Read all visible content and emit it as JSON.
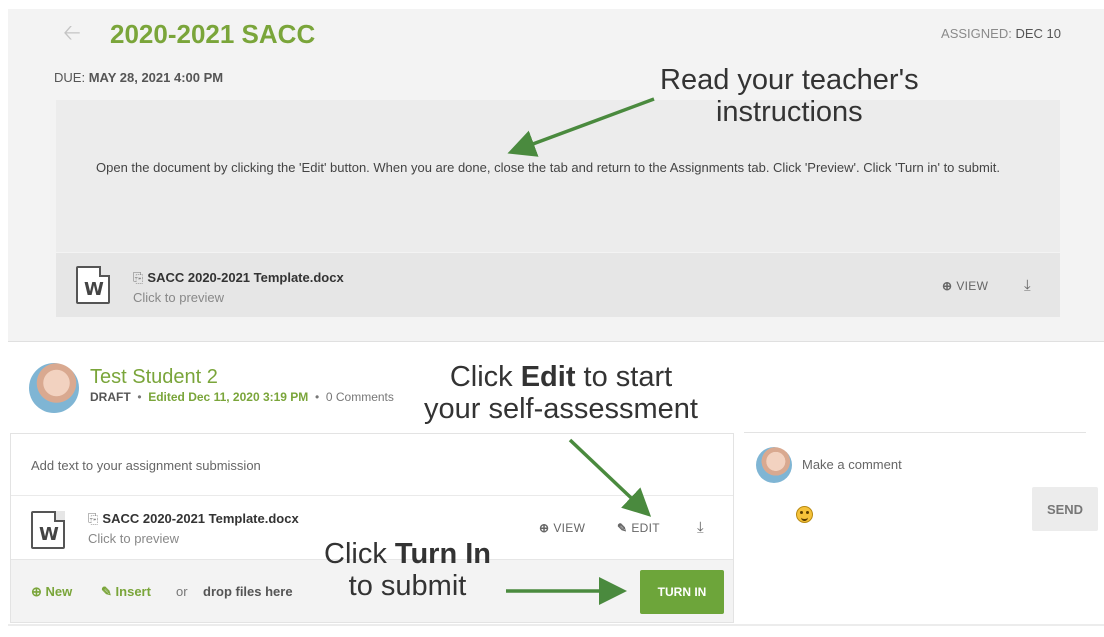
{
  "assignment": {
    "title": "2020-2021 SACC",
    "assigned_label": "ASSIGNED:",
    "assigned_date": "DEC 10",
    "due_label": "DUE:",
    "due_date": "MAY 28, 2021 4:00 PM",
    "instructions": "Open the document by clicking the 'Edit' button.  When you are done, close the tab and return to the Assignments tab.  Click 'Preview'.  Click 'Turn in' to submit.",
    "attachment": {
      "name": "SACC 2020-2021 Template.docx",
      "subtitle": "Click to preview",
      "view_label": "VIEW"
    }
  },
  "submission": {
    "student_name": "Test Student 2",
    "status": "DRAFT",
    "edited": "Edited Dec 11, 2020 3:19 PM",
    "comments": "0 Comments",
    "text_placeholder": "Add text to your assignment submission",
    "attachment": {
      "name": "SACC 2020-2021 Template.docx",
      "subtitle": "Click to preview",
      "view_label": "VIEW",
      "edit_label": "EDIT"
    },
    "tools": {
      "new_label": "New",
      "insert_label": "Insert",
      "or_text": "or",
      "drop_text": "drop files here"
    },
    "turn_in_label": "TURN IN"
  },
  "comments": {
    "placeholder": "Make a comment",
    "send_label": "SEND"
  },
  "annotations": {
    "read": {
      "line1": "Read your teacher's",
      "line2": "instructions"
    },
    "edit": {
      "pre": "Click ",
      "bold": "Edit",
      "post": " to start",
      "line2": "your self-assessment"
    },
    "turnin": {
      "pre": "Click ",
      "bold": "Turn In",
      "line2": "to submit"
    }
  },
  "colors": {
    "accent": "#7aa53a",
    "button": "#6da53a",
    "annotation_arrow": "#4a8a3e"
  },
  "icons": [
    "back-arrow-icon",
    "word-doc-icon",
    "copy-icon",
    "zoom-icon",
    "download-icon",
    "edit-icon",
    "plus-circle-icon",
    "paperclip-icon",
    "smiley-icon"
  ]
}
